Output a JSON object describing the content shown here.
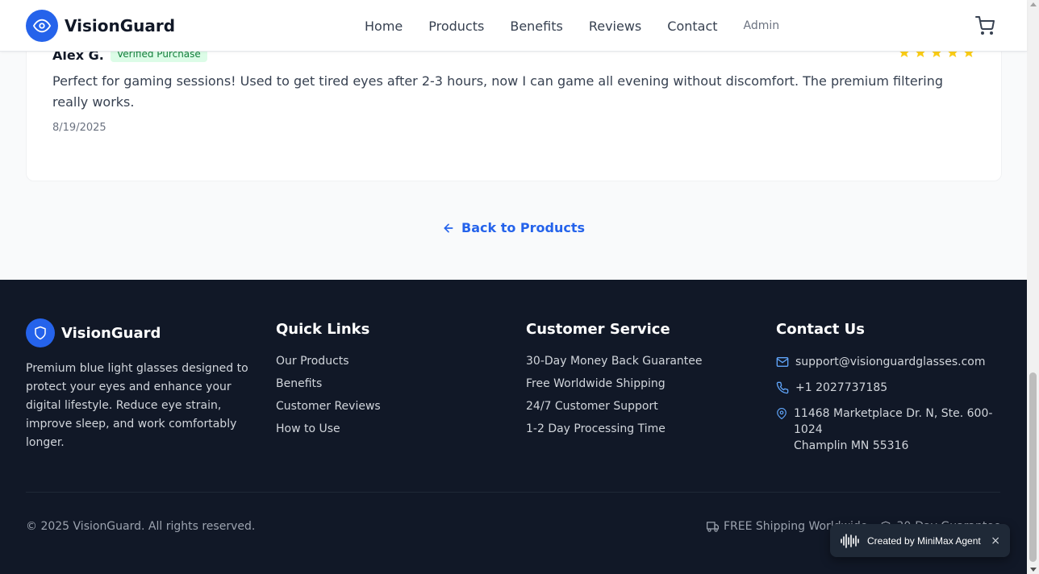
{
  "header": {
    "brand": "VisionGuard",
    "nav": [
      "Home",
      "Products",
      "Benefits",
      "Reviews",
      "Contact"
    ],
    "admin": "Admin",
    "logo_icon": "eye-icon",
    "cart_icon": "shopping-cart-icon"
  },
  "review": {
    "reviewer": "Alex G.",
    "badge": "Verified Purchase",
    "rating": 5,
    "text": "Perfect for gaming sessions! Used to get tired eyes after 2-3 hours, now I can game all evening without discomfort. The premium filtering really works.",
    "date": "8/19/2025"
  },
  "back_link": "Back to Products",
  "footer": {
    "brand": "VisionGuard",
    "brand_icon": "shield-icon",
    "description": "Premium blue light glasses designed to protect your eyes and enhance your digital lifestyle. Reduce eye strain, improve sleep, and work comfortably longer.",
    "quick_links": {
      "title": "Quick Links",
      "items": [
        "Our Products",
        "Benefits",
        "Customer Reviews",
        "How to Use"
      ]
    },
    "customer_service": {
      "title": "Customer Service",
      "items": [
        "30-Day Money Back Guarantee",
        "Free Worldwide Shipping",
        "24/7 Customer Support",
        "1-2 Day Processing Time"
      ]
    },
    "contact": {
      "title": "Contact Us",
      "email": "support@visionguardglasses.com",
      "phone": "+1 2027737185",
      "address_line1": "11468 Marketplace Dr. N, Ste. 600-1024",
      "address_line2": "Champlin MN 55316"
    },
    "copyright": "© 2025 VisionGuard. All rights reserved.",
    "badge_shipping": "FREE Shipping Worldwide",
    "badge_guarantee": "30-Day Guarantee"
  },
  "toast": {
    "text": "Created by MiniMax Agent",
    "close": "×"
  },
  "colors": {
    "primary": "#2563eb",
    "footer_bg": "#111827",
    "star": "#facc15",
    "verified_bg": "#dcfce7",
    "verified_text": "#15803d"
  }
}
